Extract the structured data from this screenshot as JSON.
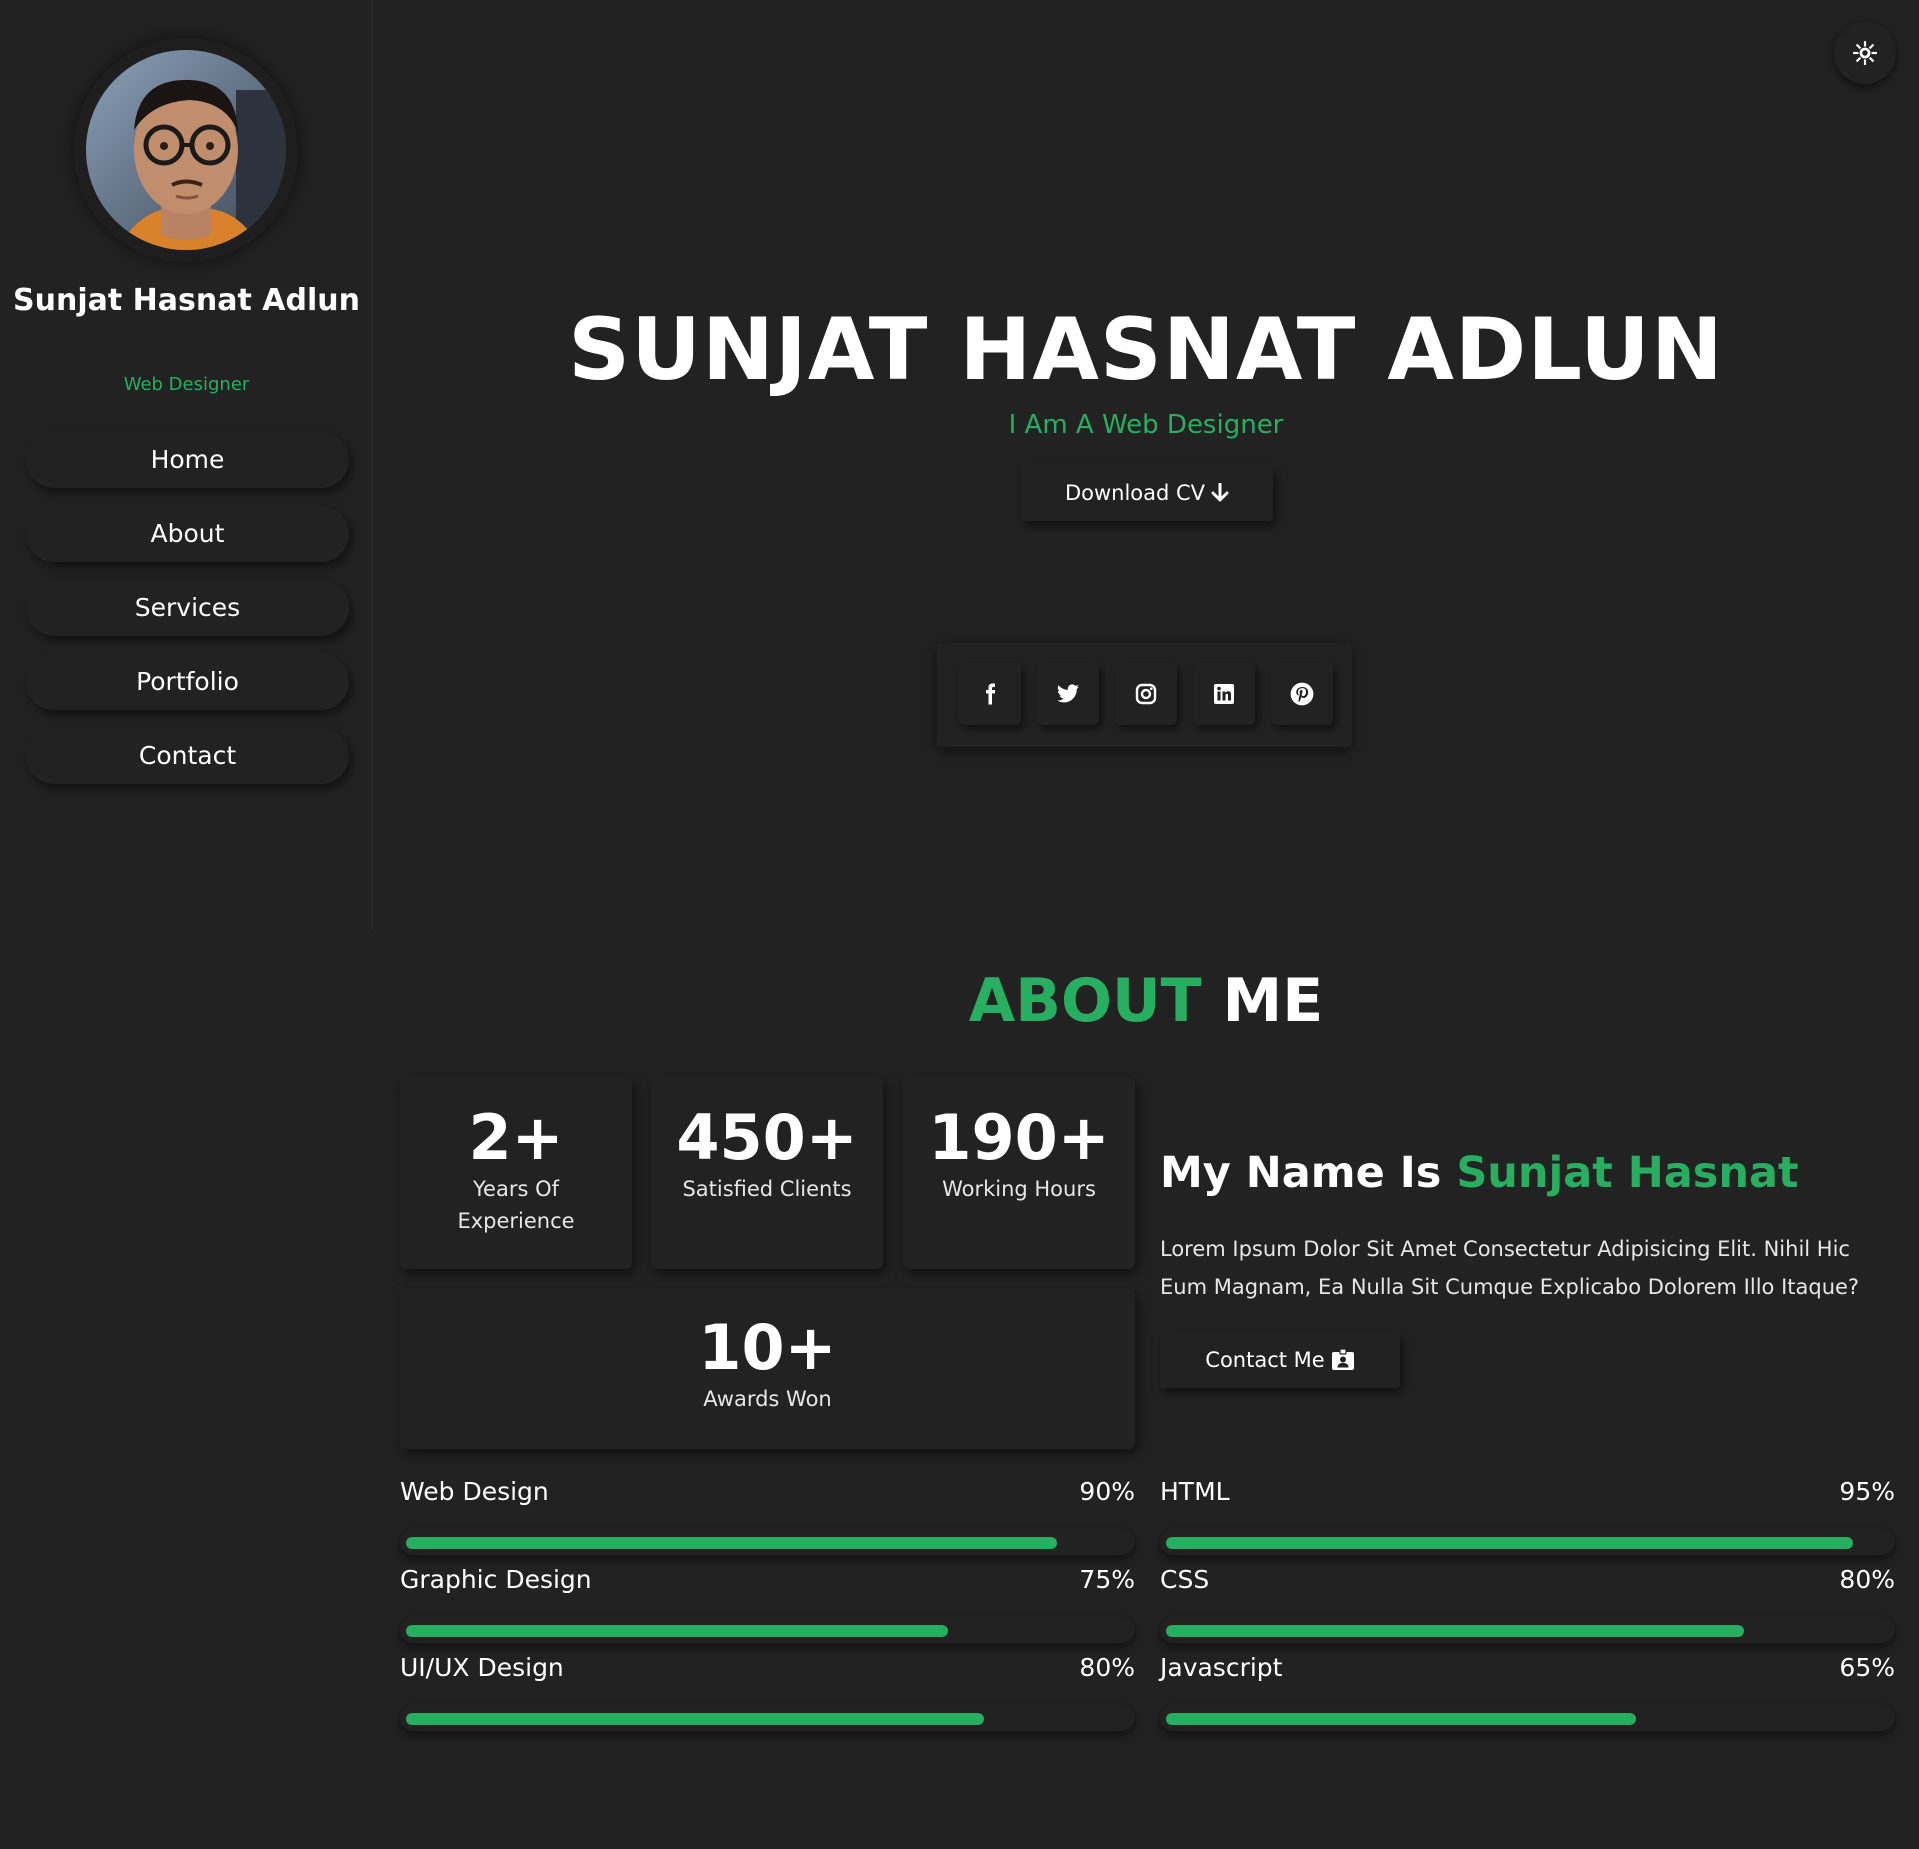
{
  "colors": {
    "background": "#222222",
    "accent": "#27ae60",
    "text": "#ffffff"
  },
  "sidebar": {
    "name": "Sunjat Hasnat Adlun",
    "role": "Web Designer",
    "nav": [
      {
        "label": "Home"
      },
      {
        "label": "About"
      },
      {
        "label": "Services"
      },
      {
        "label": "Portfolio"
      },
      {
        "label": "Contact"
      }
    ]
  },
  "theme_toggle": {
    "icon": "sun-icon"
  },
  "hero": {
    "title": "SUNJAT HASNAT ADLUN",
    "subtitle": "I Am A Web Designer",
    "cv_button": "Download CV",
    "social": [
      {
        "icon": "facebook-icon"
      },
      {
        "icon": "twitter-icon"
      },
      {
        "icon": "instagram-icon"
      },
      {
        "icon": "linkedin-icon"
      },
      {
        "icon": "pinterest-icon"
      }
    ]
  },
  "about": {
    "title_accent": "ABOUT",
    "title_rest": "ME",
    "stats": [
      {
        "number": "2+",
        "label": "Years Of Experience"
      },
      {
        "number": "450+",
        "label": "Satisfied Clients"
      },
      {
        "number": "190+",
        "label": "Working Hours"
      },
      {
        "number": "10+",
        "label": "Awards Won"
      }
    ],
    "heading_prefix": "My Name Is",
    "heading_name": "Sunjat Hasnat",
    "text": "Lorem Ipsum Dolor Sit Amet Consectetur Adipisicing Elit. Nihil Hic Eum Magnam, Ea Nulla Sit Cumque Explicabo Dolorem Illo Itaque?",
    "contact_button": "Contact Me"
  },
  "skills": [
    {
      "name": "Web Design",
      "percent_label": "90%",
      "value": 90
    },
    {
      "name": "HTML",
      "percent_label": "95%",
      "value": 95
    },
    {
      "name": "Graphic Design",
      "percent_label": "75%",
      "value": 75
    },
    {
      "name": "CSS",
      "percent_label": "80%",
      "value": 80
    },
    {
      "name": "UI/UX Design",
      "percent_label": "80%",
      "value": 80
    },
    {
      "name": "Javascript",
      "percent_label": "65%",
      "value": 65
    }
  ]
}
